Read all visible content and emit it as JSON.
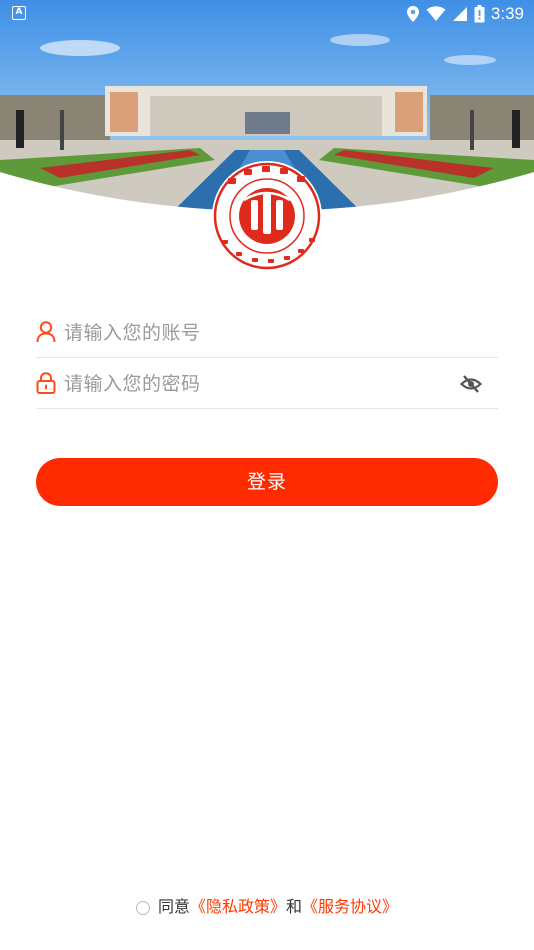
{
  "status_bar": {
    "left_badge": "A",
    "time": "3:39"
  },
  "login": {
    "account_placeholder": "请输入您的账号",
    "password_placeholder": "请输入您的密码",
    "login_button": "登录"
  },
  "agreement": {
    "prefix": "同意",
    "privacy_link": "《隐私政策》",
    "conjunction": "和",
    "service_link": "《服务协议》"
  },
  "colors": {
    "accent": "#ff2a00",
    "link": "#ff3a00",
    "logo_red": "#e02a1c"
  },
  "icons": {
    "account": "person-icon",
    "password": "lock-icon",
    "visibility": "eye-off-icon",
    "location": "location-icon",
    "wifi": "wifi-icon",
    "signal": "signal-icon",
    "battery": "battery-icon"
  }
}
